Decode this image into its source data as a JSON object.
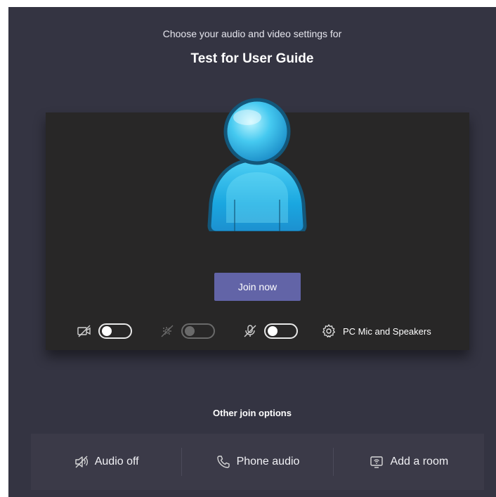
{
  "header": {
    "subtitle": "Choose your audio and video settings for",
    "meeting_title": "Test for User Guide"
  },
  "preview": {
    "join_label": "Join now",
    "controls": [
      {
        "icon": "camera-off-icon",
        "state": "off"
      },
      {
        "icon": "background-blur-icon",
        "state": "off",
        "disabled": true
      },
      {
        "icon": "mic-off-icon",
        "state": "off"
      }
    ],
    "device_label": "PC Mic and Speakers"
  },
  "other_options": {
    "heading": "Other join options",
    "items": [
      {
        "icon": "speaker-off-icon",
        "label": "Audio off"
      },
      {
        "icon": "phone-icon",
        "label": "Phone audio"
      },
      {
        "icon": "cast-room-icon",
        "label": "Add a room"
      }
    ]
  },
  "colors": {
    "background": "#343442",
    "preview_bg": "#282727",
    "accent": "#6264a7",
    "options_bg": "#3b3a48"
  }
}
